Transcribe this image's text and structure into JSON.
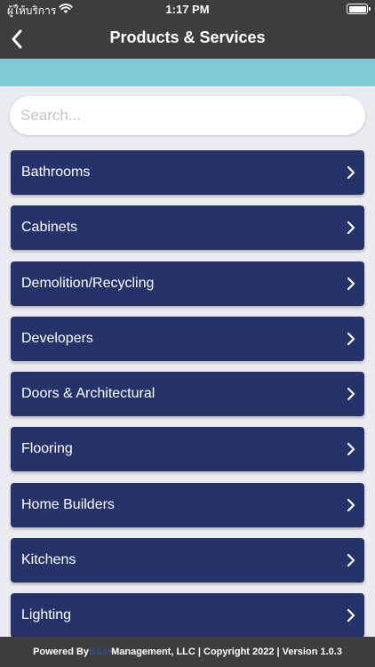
{
  "status_bar": {
    "carrier": "ผู้ให้บริการ",
    "time": "1:17 PM",
    "wifi_icon": "wifi-icon",
    "battery_icon": "battery-icon"
  },
  "nav": {
    "title": "Products & Services",
    "back_icon": "chevron-left-icon"
  },
  "banner_color": "#7ecad4",
  "search": {
    "placeholder": "Search..."
  },
  "categories": [
    {
      "label": "Bathrooms"
    },
    {
      "label": "Cabinets"
    },
    {
      "label": "Demolition/Recycling"
    },
    {
      "label": "Developers"
    },
    {
      "label": "Doors & Architectural"
    },
    {
      "label": "Flooring"
    },
    {
      "label": "Home Builders"
    },
    {
      "label": "Kitchens"
    },
    {
      "label": "Lighting"
    }
  ],
  "footer": {
    "prefix": "Powered By ",
    "brand": "B&M",
    "suffix": " Management, LLC | Copyright 2022 | Version 1.0.3"
  },
  "colors": {
    "header": "#3d3d3d",
    "list_item": "#26326a",
    "background": "#ebebf1"
  }
}
